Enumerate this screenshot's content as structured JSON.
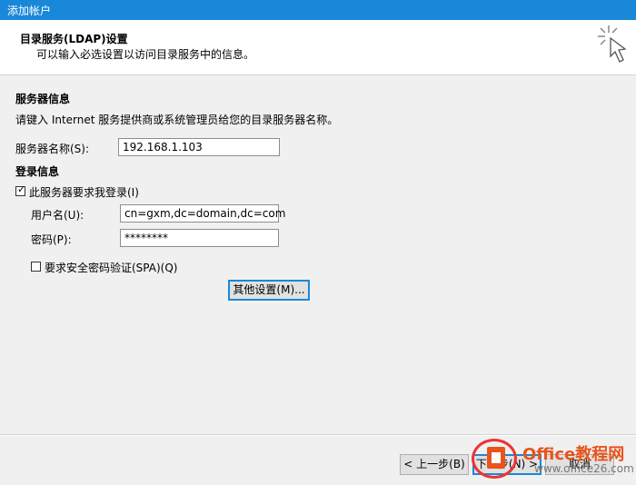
{
  "window": {
    "title": "添加帐户"
  },
  "header": {
    "title": "目录服务(LDAP)设置",
    "subtitle": "可以输入必选设置以访问目录服务中的信息。"
  },
  "server_section": {
    "heading": "服务器信息",
    "instruction": "请键入 Internet 服务提供商或系统管理员给您的目录服务器名称。",
    "server_name_label": "服务器名称(S):",
    "server_name_value": "192.168.1.103"
  },
  "login_section": {
    "heading": "登录信息",
    "requires_login_label": "此服务器要求我登录(I)",
    "requires_login_checked": true,
    "username_label": "用户名(U):",
    "username_value": "cn=gxm,dc=domain,dc=com",
    "password_label": "密码(P):",
    "password_value": "********",
    "spa_label": "要求安全密码验证(SPA)(Q)",
    "spa_checked": false
  },
  "buttons": {
    "more_settings": "其他设置(M)...",
    "back": "< 上一步(B)",
    "next": "下一步(N) >",
    "cancel": "取消"
  },
  "watermark": {
    "brand": "Office教程网",
    "url": "www.office26.com"
  },
  "colors": {
    "titlebar": "#1a88d9",
    "focus_border": "#1a88d9",
    "watermark": "#e8541c"
  }
}
